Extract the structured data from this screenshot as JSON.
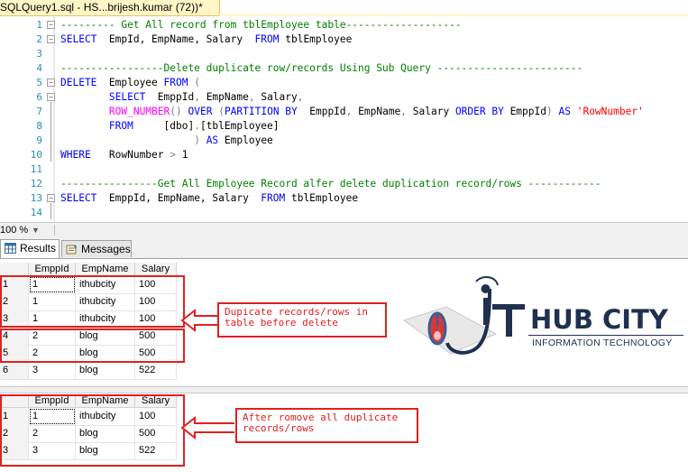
{
  "window": {
    "tab_title": "SQLQuery1.sql - HS...brijesh.kumar (72))*"
  },
  "editor": {
    "lines": [
      {
        "n": "1",
        "segs": [
          {
            "c": "cm",
            "t": "--------- Get All record from tblEmployee table-------------------"
          }
        ]
      },
      {
        "n": "2",
        "segs": [
          {
            "c": "kw",
            "t": "SELECT"
          },
          {
            "c": "",
            "t": "  EmpId, EmpName, Salary  "
          },
          {
            "c": "kw",
            "t": "FROM"
          },
          {
            "c": "",
            "t": " tblEmployee"
          }
        ]
      },
      {
        "n": "3",
        "segs": []
      },
      {
        "n": "4",
        "segs": [
          {
            "c": "cm",
            "t": "-----------------Delete duplicate row/records Using Sub Query ------------------------"
          }
        ]
      },
      {
        "n": "5",
        "segs": [
          {
            "c": "kw",
            "t": "DELETE"
          },
          {
            "c": "",
            "t": "  Employee "
          },
          {
            "c": "kw",
            "t": "FROM"
          },
          {
            "c": "gr",
            "t": " ("
          }
        ]
      },
      {
        "n": "6",
        "segs": [
          {
            "c": "",
            "t": "        "
          },
          {
            "c": "kw",
            "t": "SELECT"
          },
          {
            "c": "",
            "t": "  EmppId"
          },
          {
            "c": "gr",
            "t": ","
          },
          {
            "c": "",
            "t": " EmpName"
          },
          {
            "c": "gr",
            "t": ","
          },
          {
            "c": "",
            "t": " Salary"
          },
          {
            "c": "gr",
            "t": ","
          }
        ]
      },
      {
        "n": "7",
        "segs": [
          {
            "c": "",
            "t": "        "
          },
          {
            "c": "fn",
            "t": "ROW_NUMBER"
          },
          {
            "c": "gr",
            "t": "()"
          },
          {
            "c": "",
            "t": " "
          },
          {
            "c": "kw",
            "t": "OVER"
          },
          {
            "c": "",
            "t": " "
          },
          {
            "c": "gr",
            "t": "("
          },
          {
            "c": "kw",
            "t": "PARTITION BY"
          },
          {
            "c": "",
            "t": "  EmppId"
          },
          {
            "c": "gr",
            "t": ","
          },
          {
            "c": "",
            "t": " EmpName"
          },
          {
            "c": "gr",
            "t": ","
          },
          {
            "c": "",
            "t": " Salary "
          },
          {
            "c": "kw",
            "t": "ORDER BY"
          },
          {
            "c": "",
            "t": " EmppId"
          },
          {
            "c": "gr",
            "t": ")"
          },
          {
            "c": "",
            "t": " "
          },
          {
            "c": "kw",
            "t": "AS"
          },
          {
            "c": "",
            "t": " "
          },
          {
            "c": "st",
            "t": "'RowNumber'"
          }
        ]
      },
      {
        "n": "8",
        "segs": [
          {
            "c": "",
            "t": "        "
          },
          {
            "c": "kw",
            "t": "FROM"
          },
          {
            "c": "",
            "t": "     [dbo]"
          },
          {
            "c": "gr",
            "t": "."
          },
          {
            "c": "",
            "t": "[tblEmployee]"
          }
        ]
      },
      {
        "n": "9",
        "segs": [
          {
            "c": "",
            "t": "                      "
          },
          {
            "c": "gr",
            "t": ")"
          },
          {
            "c": "",
            "t": " "
          },
          {
            "c": "kw",
            "t": "AS"
          },
          {
            "c": "",
            "t": " Employee"
          }
        ]
      },
      {
        "n": "10",
        "segs": [
          {
            "c": "kw",
            "t": "WHERE"
          },
          {
            "c": "",
            "t": "   RowNumber "
          },
          {
            "c": "gr",
            "t": ">"
          },
          {
            "c": "",
            "t": " 1"
          }
        ]
      },
      {
        "n": "11",
        "segs": []
      },
      {
        "n": "12",
        "segs": [
          {
            "c": "cm",
            "t": "----------------Get All Employee Record alfer delete duplication record/rows ------------"
          }
        ]
      },
      {
        "n": "13",
        "segs": [
          {
            "c": "kw",
            "t": "SELECT"
          },
          {
            "c": "",
            "t": "  EmppId, EmpName, Salary  "
          },
          {
            "c": "kw",
            "t": "FROM"
          },
          {
            "c": "",
            "t": " tblEmployee"
          }
        ]
      },
      {
        "n": "14",
        "segs": []
      }
    ]
  },
  "zoom": {
    "level": "100 %"
  },
  "result_tabs": [
    {
      "label": "Results",
      "icon": "grid-icon",
      "selected": true
    },
    {
      "label": "Messages",
      "icon": "message-icon",
      "selected": false
    }
  ],
  "grid1": {
    "columns": [
      "EmppId",
      "EmpName",
      "Salary"
    ],
    "rows": [
      {
        "num": "1",
        "c": [
          "1",
          "ithubcity",
          "100"
        ]
      },
      {
        "num": "2",
        "c": [
          "1",
          "ithubcity",
          "100"
        ]
      },
      {
        "num": "3",
        "c": [
          "1",
          "ithubcity",
          "100"
        ]
      },
      {
        "num": "4",
        "c": [
          "2",
          "blog",
          "500"
        ]
      },
      {
        "num": "5",
        "c": [
          "2",
          "blog",
          "500"
        ]
      },
      {
        "num": "6",
        "c": [
          "3",
          "blog",
          "522"
        ]
      }
    ]
  },
  "grid2": {
    "columns": [
      "EmppId",
      "EmpName",
      "Salary"
    ],
    "rows": [
      {
        "num": "1",
        "c": [
          "1",
          "ithubcity",
          "100"
        ]
      },
      {
        "num": "2",
        "c": [
          "2",
          "blog",
          "500"
        ]
      },
      {
        "num": "3",
        "c": [
          "3",
          "blog",
          "522"
        ]
      }
    ]
  },
  "annotations": {
    "callout1": "Dupicate records/rows in\ntable before delete",
    "callout2": "After romove all duplicate\nrecords/rows",
    "accent_color": "#e02020"
  },
  "logo": {
    "name": "HUB CITY",
    "tagline": "INFORMATION TECHNOLOGY"
  }
}
